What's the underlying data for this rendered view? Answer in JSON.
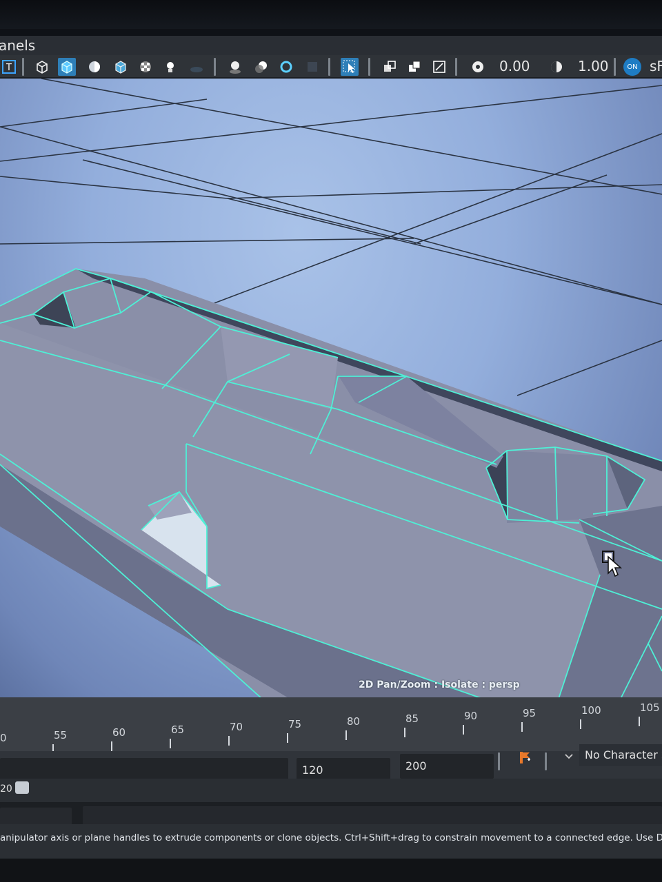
{
  "menu": {
    "panels_label": "anels"
  },
  "toolbar": {
    "icons": [
      "wireframe-icon",
      "smooth-shade-icon",
      "flat-shade-icon",
      "textured-icon",
      "xray-icon",
      "checker-icon",
      "lights-icon"
    ],
    "value_a": "0.00",
    "value_b": "1.00",
    "on_badge": "ON",
    "trailing_label": "sF"
  },
  "viewport": {
    "hud_text": "2D Pan/Zoom : Isolate : persp",
    "background_color": "#93aedc",
    "wire_color": "#4ef0d6"
  },
  "timeline": {
    "ticks": [
      "0",
      "55",
      "60",
      "65",
      "70",
      "75",
      "80",
      "85",
      "90",
      "95",
      "100",
      "105"
    ]
  },
  "range": {
    "end_playback": "120",
    "end_animation": "200",
    "current_frame": "20",
    "character_set": "No Character S"
  },
  "help_line": {
    "text": "anipulator axis or plane handles to extrude components or clone objects. Ctrl+Shift+drag to constrain movement to a connected edge. Use D"
  }
}
